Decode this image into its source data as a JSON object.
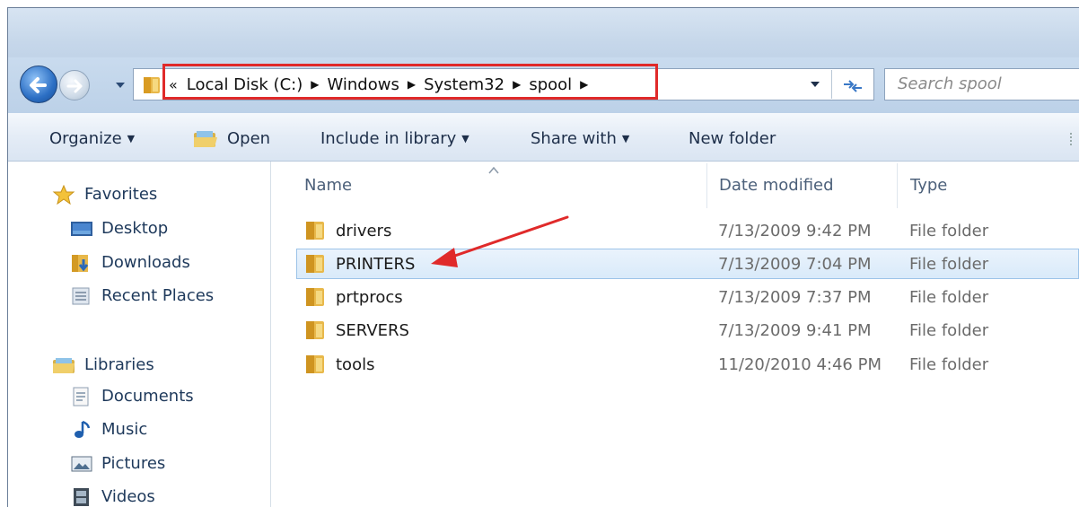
{
  "address": {
    "overflow": "«",
    "crumbs": [
      "Local Disk (C:)",
      "Windows",
      "System32",
      "spool"
    ]
  },
  "search": {
    "placeholder": "Search spool"
  },
  "toolbar": {
    "organize": "Organize",
    "open": "Open",
    "include": "Include in library",
    "share": "Share with",
    "new_folder": "New folder"
  },
  "nav": {
    "favorites": "Favorites",
    "desktop": "Desktop",
    "downloads": "Downloads",
    "recent": "Recent Places",
    "libraries": "Libraries",
    "documents": "Documents",
    "music": "Music",
    "pictures": "Pictures",
    "videos": "Videos"
  },
  "columns": {
    "name": "Name",
    "date": "Date modified",
    "type": "Type"
  },
  "files": [
    {
      "name": "drivers",
      "date": "7/13/2009 9:42 PM",
      "type": "File folder"
    },
    {
      "name": "PRINTERS",
      "date": "7/13/2009 7:04 PM",
      "type": "File folder"
    },
    {
      "name": "prtprocs",
      "date": "7/13/2009 7:37 PM",
      "type": "File folder"
    },
    {
      "name": "SERVERS",
      "date": "7/13/2009 9:41 PM",
      "type": "File folder"
    },
    {
      "name": "tools",
      "date": "11/20/2010 4:46 PM",
      "type": "File folder"
    }
  ],
  "colors": {
    "highlight_box": "#e02a2a",
    "arrow": "#e02a2a",
    "selection": "#d9eafa"
  }
}
